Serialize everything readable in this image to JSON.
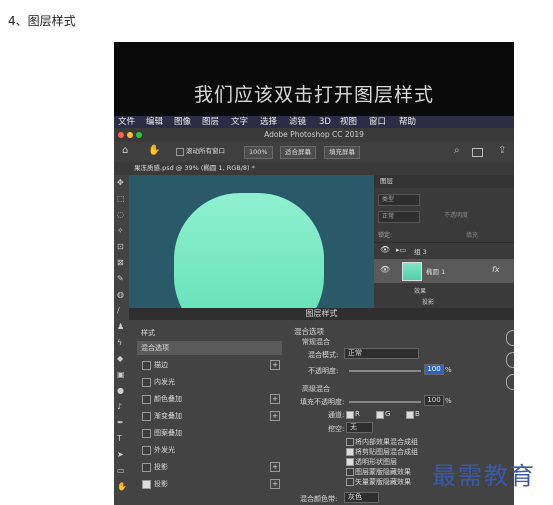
{
  "step_label": "4、图层样式",
  "banner": "我们应该双击打开图层样式",
  "menu": [
    "文件",
    "编辑",
    "图像",
    "图层",
    "文字",
    "选择",
    "滤镜",
    "3D",
    "视图",
    "窗口",
    "帮助"
  ],
  "window_title": "Adobe Photoshop CC 2019",
  "options": {
    "scroll_all": "滚动所有窗口",
    "zoom": "100%",
    "fit": "适合屏幕",
    "fill": "填充屏幕"
  },
  "doc_tab": "果冻质感.psd @ 39% (椭圆 1, RGB/8) *",
  "layers_panel": {
    "title": "图层",
    "search": "类型",
    "mode": "正常",
    "opacity_label": "不透明度",
    "lock_label": "锁定:",
    "fill_label": "填充",
    "group": "组 3",
    "layer": "椭圆 1",
    "fx": "fx",
    "effects": "效果",
    "shadow": "投影"
  },
  "dialog": {
    "title": "图层样式",
    "list": [
      {
        "label": "样式",
        "checkbox": false,
        "checked": false,
        "plus": false
      },
      {
        "label": "混合选项",
        "checkbox": false,
        "checked": false,
        "plus": false,
        "active": true
      },
      {
        "label": "描边",
        "checkbox": true,
        "checked": false,
        "plus": true
      },
      {
        "label": "内发光",
        "checkbox": true,
        "checked": false,
        "plus": false
      },
      {
        "label": "颜色叠加",
        "checkbox": true,
        "checked": false,
        "plus": true
      },
      {
        "label": "渐变叠加",
        "checkbox": true,
        "checked": false,
        "plus": true
      },
      {
        "label": "图案叠加",
        "checkbox": true,
        "checked": false,
        "plus": false
      },
      {
        "label": "外发光",
        "checkbox": true,
        "checked": false,
        "plus": false
      },
      {
        "label": "投影",
        "checkbox": true,
        "checked": false,
        "plus": true
      },
      {
        "label": "投影",
        "checkbox": true,
        "checked": true,
        "plus": true
      }
    ],
    "blend_options": "混合选项",
    "general": "常规混合",
    "blend_mode_label": "混合模式:",
    "blend_mode": "正常",
    "opacity_label": "不透明度:",
    "opacity_value": "100",
    "percent": "%",
    "advanced": "高级混合",
    "fill_opacity_label": "填充不透明度:",
    "fill_opacity_value": "100",
    "channels_label": "通道:",
    "channels": [
      "R",
      "G",
      "B"
    ],
    "knockout_label": "挖空:",
    "knockout_value": "无",
    "checks": [
      {
        "label": "将内部效果混合成组",
        "checked": false
      },
      {
        "label": "将剪贴图层混合成组",
        "checked": true
      },
      {
        "label": "透明形状图层",
        "checked": true
      },
      {
        "label": "图层蒙版隐藏效果",
        "checked": false
      },
      {
        "label": "矢量蒙版隐藏效果",
        "checked": false
      }
    ],
    "blend_if_label": "混合颜色带:",
    "blend_if_value": "灰色"
  },
  "watermark": "最需教育"
}
